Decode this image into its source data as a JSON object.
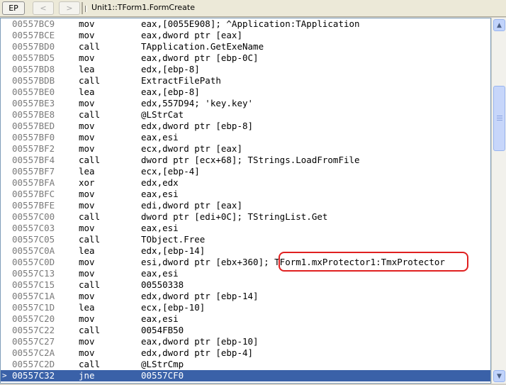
{
  "toolbar": {
    "ep_label": "EP",
    "back_label": "<",
    "forward_label": ">",
    "title": "Unit1::TForm1.FormCreate"
  },
  "disasm": {
    "rows": [
      {
        "addr": "00557BC9",
        "mnemonic": "mov",
        "operands": "eax,[0055E908]; ^Application:TApplication"
      },
      {
        "addr": "00557BCE",
        "mnemonic": "mov",
        "operands": "eax,dword ptr [eax]"
      },
      {
        "addr": "00557BD0",
        "mnemonic": "call",
        "operands": "TApplication.GetExeName"
      },
      {
        "addr": "00557BD5",
        "mnemonic": "mov",
        "operands": "eax,dword ptr [ebp-0C]"
      },
      {
        "addr": "00557BD8",
        "mnemonic": "lea",
        "operands": "edx,[ebp-8]"
      },
      {
        "addr": "00557BDB",
        "mnemonic": "call",
        "operands": "ExtractFilePath"
      },
      {
        "addr": "00557BE0",
        "mnemonic": "lea",
        "operands": "eax,[ebp-8]"
      },
      {
        "addr": "00557BE3",
        "mnemonic": "mov",
        "operands": "edx,557D94; 'key.key'"
      },
      {
        "addr": "00557BE8",
        "mnemonic": "call",
        "operands": "@LStrCat"
      },
      {
        "addr": "00557BED",
        "mnemonic": "mov",
        "operands": "edx,dword ptr [ebp-8]"
      },
      {
        "addr": "00557BF0",
        "mnemonic": "mov",
        "operands": "eax,esi"
      },
      {
        "addr": "00557BF2",
        "mnemonic": "mov",
        "operands": "ecx,dword ptr [eax]"
      },
      {
        "addr": "00557BF4",
        "mnemonic": "call",
        "operands": "dword ptr [ecx+68]; TStrings.LoadFromFile"
      },
      {
        "addr": "00557BF7",
        "mnemonic": "lea",
        "operands": "ecx,[ebp-4]"
      },
      {
        "addr": "00557BFA",
        "mnemonic": "xor",
        "operands": "edx,edx"
      },
      {
        "addr": "00557BFC",
        "mnemonic": "mov",
        "operands": "eax,esi"
      },
      {
        "addr": "00557BFE",
        "mnemonic": "mov",
        "operands": "edi,dword ptr [eax]"
      },
      {
        "addr": "00557C00",
        "mnemonic": "call",
        "operands": "dword ptr [edi+0C]; TStringList.Get"
      },
      {
        "addr": "00557C03",
        "mnemonic": "mov",
        "operands": "eax,esi"
      },
      {
        "addr": "00557C05",
        "mnemonic": "call",
        "operands": "TObject.Free"
      },
      {
        "addr": "00557C0A",
        "mnemonic": "lea",
        "operands": "edx,[ebp-14]"
      },
      {
        "addr": "00557C0D",
        "mnemonic": "mov",
        "operands": "esi,dword ptr [ebx+360]; TForm1.mxProtector1:TmxProtector"
      },
      {
        "addr": "00557C13",
        "mnemonic": "mov",
        "operands": "eax,esi"
      },
      {
        "addr": "00557C15",
        "mnemonic": "call",
        "operands": "00550338"
      },
      {
        "addr": "00557C1A",
        "mnemonic": "mov",
        "operands": "edx,dword ptr [ebp-14]"
      },
      {
        "addr": "00557C1D",
        "mnemonic": "lea",
        "operands": "ecx,[ebp-10]"
      },
      {
        "addr": "00557C20",
        "mnemonic": "mov",
        "operands": "eax,esi"
      },
      {
        "addr": "00557C22",
        "mnemonic": "call",
        "operands": "0054FB50"
      },
      {
        "addr": "00557C27",
        "mnemonic": "mov",
        "operands": "eax,dword ptr [ebp-10]"
      },
      {
        "addr": "00557C2A",
        "mnemonic": "mov",
        "operands": "edx,dword ptr [ebp-4]"
      },
      {
        "addr": "00557C2D",
        "mnemonic": "call",
        "operands": "@LStrCmp"
      },
      {
        "addr": "00557C32",
        "mnemonic": "jne",
        "operands": "00557CF0",
        "selected": true,
        "marker": ">"
      }
    ]
  },
  "scrollbar": {
    "up_icon": "▲",
    "down_icon": "▼"
  },
  "colors": {
    "selection": "#3a61a8",
    "highlight_box": "#e02020"
  }
}
